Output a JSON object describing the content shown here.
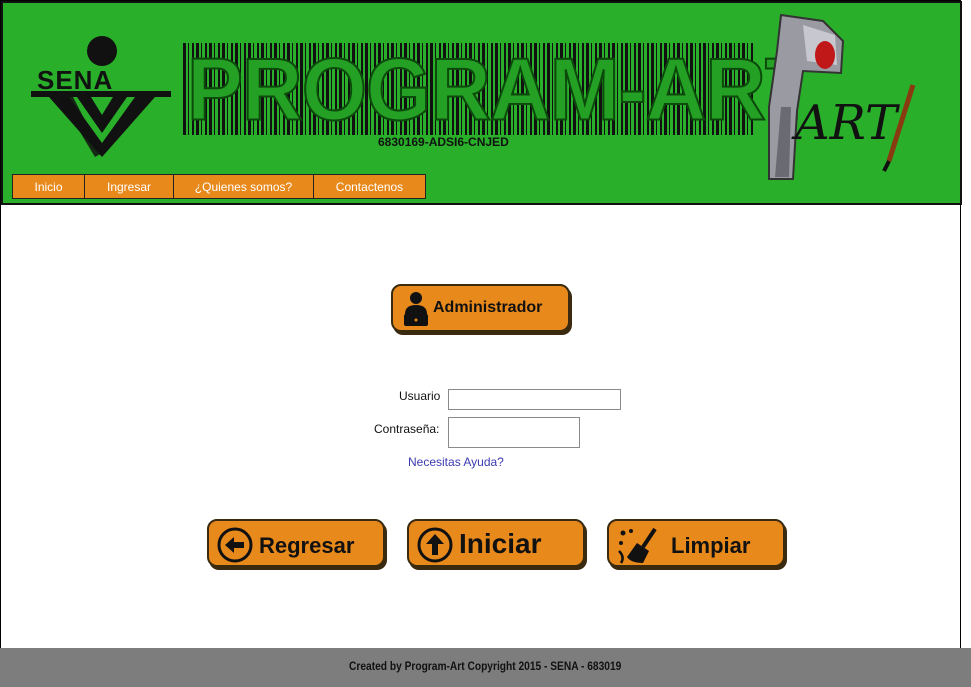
{
  "header": {
    "logo_text": "SENA",
    "brand_title": "PROGRAM-ART",
    "code_line": "6830169-ADSI6-CNJED",
    "art_logo_text": "ART"
  },
  "nav": {
    "items": [
      {
        "label": "Inicio"
      },
      {
        "label": "Ingresar"
      },
      {
        "label": "¿Quienes somos?"
      },
      {
        "label": "Contactenos"
      }
    ]
  },
  "admin_button": {
    "label": "Administrador",
    "icon": "admin-user-icon"
  },
  "login_form": {
    "user_label": "Usuario",
    "user_value": "",
    "password_label": "Contraseña:",
    "password_value": "",
    "help_link": "Necesitas Ayuda?"
  },
  "actions": {
    "back_label": "Regresar",
    "back_icon": "arrow-left-circle-icon",
    "start_label": "Iniciar",
    "start_icon": "arrow-up-circle-icon",
    "clear_label": "Limpiar",
    "clear_icon": "broom-icon"
  },
  "footer": {
    "text": "Created by Program-Art  Copyright 2015 - SENA - 683019"
  },
  "colors": {
    "header_bg": "#2aaf2a",
    "button_orange": "#e8891b",
    "footer_bg": "#7d7d7d",
    "link": "#3b3bb0"
  }
}
